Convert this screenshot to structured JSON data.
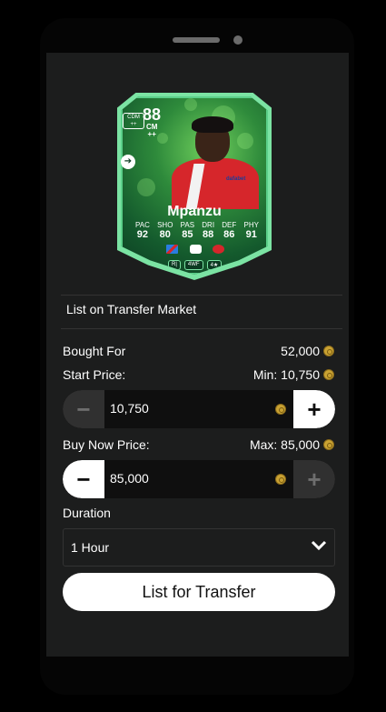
{
  "card": {
    "rating": "88",
    "position_badge": "CDM",
    "position_badge_plus": "++",
    "alt_position": "CM",
    "alt_position_plus": "++",
    "name": "Mpanzu",
    "sponsor": "dafabet",
    "stats": [
      {
        "label": "PAC",
        "value": "92"
      },
      {
        "label": "SHO",
        "value": "80"
      },
      {
        "label": "PAS",
        "value": "85"
      },
      {
        "label": "DRI",
        "value": "88"
      },
      {
        "label": "DEF",
        "value": "86"
      },
      {
        "label": "PHY",
        "value": "91"
      }
    ],
    "tags": [
      "R|",
      "4WF",
      "4★"
    ],
    "colors": {
      "accent": "#7be3a3",
      "kit": "#d6262b"
    }
  },
  "panel": {
    "title": "List on Transfer Market",
    "bought_for_label": "Bought For",
    "bought_for_value": "52,000",
    "start_price_label": "Start Price:",
    "start_price_min": "Min: 10,750",
    "start_price_value": "10,750",
    "buy_now_label": "Buy Now Price:",
    "buy_now_max": "Max: 85,000",
    "buy_now_value": "85,000",
    "duration_label": "Duration",
    "duration_value": "1 Hour",
    "list_button": "List for Transfer"
  }
}
